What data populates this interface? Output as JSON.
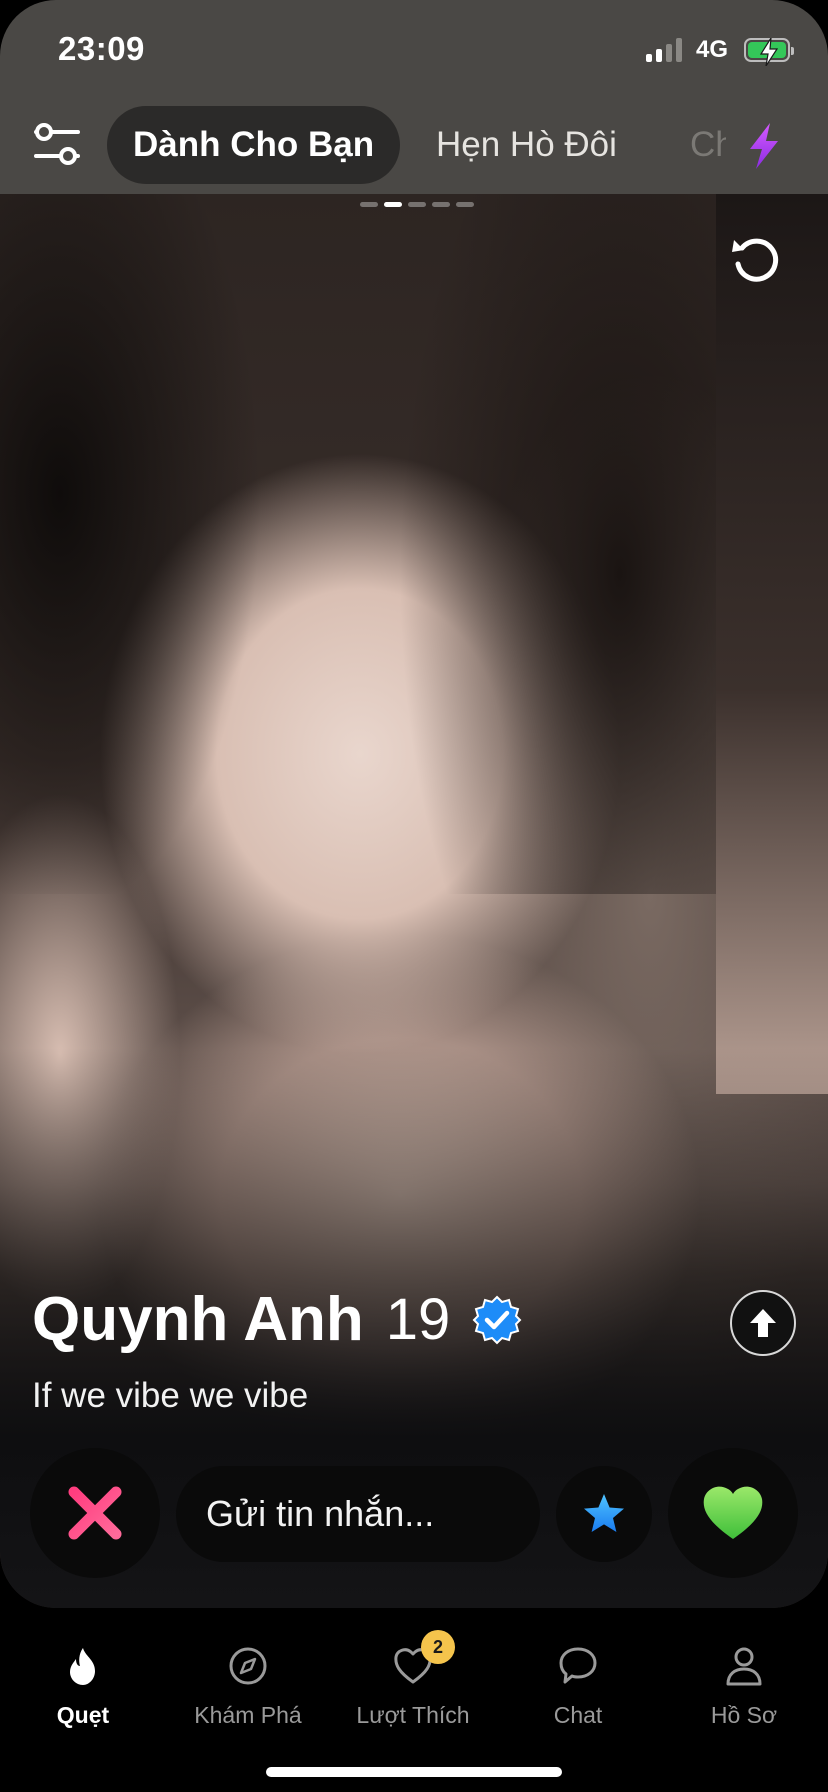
{
  "status_bar": {
    "time": "23:09",
    "network": "4G"
  },
  "header": {
    "tabs": [
      {
        "label": "Dành Cho Bạn",
        "active": true
      },
      {
        "label": "Hẹn Hò Đôi",
        "active": false
      },
      {
        "label": "Ch",
        "active": false
      }
    ]
  },
  "card": {
    "photo_index": 2,
    "photo_count": 5,
    "name": "Quynh Anh",
    "age": "19",
    "verified": true,
    "bio": "If we vibe we vibe"
  },
  "actions": {
    "message_placeholder": "Gửi tin nhắn...",
    "nope_icon": "x-icon",
    "superlike_icon": "star-icon",
    "like_icon": "heart-icon"
  },
  "nav": {
    "items": [
      {
        "label": "Quẹt",
        "icon": "flame-icon",
        "active": true
      },
      {
        "label": "Khám Phá",
        "icon": "compass-icon",
        "active": false
      },
      {
        "label": "Lượt Thích",
        "icon": "heart-outline-icon",
        "active": false,
        "badge": "2"
      },
      {
        "label": "Chat",
        "icon": "chat-bubble-icon",
        "active": false
      },
      {
        "label": "Hồ Sơ",
        "icon": "person-icon",
        "active": false
      }
    ]
  },
  "colors": {
    "header_bg": "#4a4845",
    "nope": "#ff4f8b",
    "superlike": "#1fa4ff",
    "like": "#74e055",
    "badge": "#f5c44c",
    "verified": "#1d8cf8",
    "bolt": "#b14bff"
  }
}
